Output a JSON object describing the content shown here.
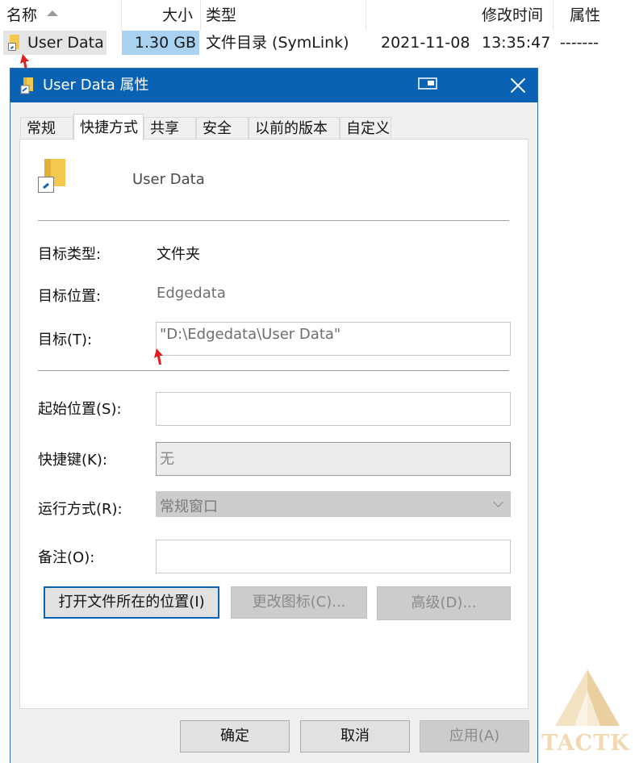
{
  "explorer": {
    "columns": {
      "name": "名称",
      "size": "大小",
      "type": "类型",
      "modified": "修改时间",
      "attributes": "属性"
    },
    "row": {
      "name": "User Data",
      "size": "1.30 GB",
      "type": "文件目录 (SymLink)",
      "date": "2021-11-08",
      "time": "13:35:47",
      "attributes": "-------"
    }
  },
  "dialog": {
    "title": "User Data 属性",
    "tabs": [
      "常规",
      "快捷方式",
      "共享",
      "安全",
      "以前的版本",
      "自定义"
    ],
    "active_tab": "快捷方式",
    "shortcut_name": "User Data",
    "fields": {
      "target_type_label": "目标类型:",
      "target_type_value": "文件夹",
      "target_location_label": "目标位置:",
      "target_location_value": "Edgedata",
      "target_label": "目标(T):",
      "target_value": "\"D:\\Edgedata\\User Data\"",
      "start_in_label": "起始位置(S):",
      "start_in_value": "",
      "hotkey_label": "快捷键(K):",
      "hotkey_value": "无",
      "run_label": "运行方式(R):",
      "run_value": "常规窗口",
      "comment_label": "备注(O):",
      "comment_value": ""
    },
    "buttons": {
      "open_location": "打开文件所在的位置(I)",
      "change_icon": "更改图标(C)...",
      "advanced": "高级(D)...",
      "ok": "确定",
      "cancel": "取消",
      "apply": "应用(A)"
    }
  },
  "watermark": {
    "text": "TACTK"
  },
  "colors": {
    "title_bar": "#0a62b5",
    "selection_size": "#a8d2ef",
    "annotation_arrow": "#e02020",
    "watermark": "#f0d9b3"
  }
}
